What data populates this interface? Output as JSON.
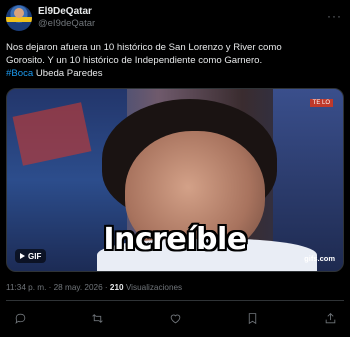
{
  "author": {
    "display_name": "El9DeQatar",
    "handle": "@eI9deQatar"
  },
  "more_icon": "ellipsis-icon",
  "tweet": {
    "line1": "Nos dejaron afuera un 10 histórico de San Lorenzo y River como",
    "line2": "Gorosito. Y un 10 histórico de Independiente como Garnero.",
    "hashtag": "#Boca",
    "line3_rest": " Ubeda Paredes"
  },
  "media": {
    "caption": "Increíble",
    "badge": "GIF",
    "source": "gifs.com",
    "tv_logo": "TE LO"
  },
  "meta": {
    "time_date": "11:34 p. m. · 28 may. 2026 · ",
    "views": "210",
    "views_label": " Visualizaciones"
  },
  "actions": [
    "reply-icon",
    "retweet-icon",
    "like-icon",
    "bookmark-icon",
    "share-icon"
  ]
}
